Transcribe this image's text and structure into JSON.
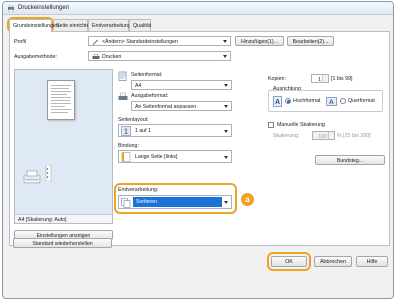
{
  "window": {
    "title": "Druckeinstellungen"
  },
  "tabs": [
    {
      "label": "Grundeinstellungen",
      "active": true
    },
    {
      "label": "Seite einrichten",
      "active": false
    },
    {
      "label": "Endverarbeitung",
      "active": false
    },
    {
      "label": "Qualität",
      "active": false
    }
  ],
  "profile": {
    "label": "Profil",
    "value": "<Ändern> Standardeinstellungen",
    "add_button": "Hinzufügen(1)...",
    "edit_button": "Bearbeiten(2)..."
  },
  "output_method": {
    "label": "Ausgabemethode:",
    "value": "Drucken"
  },
  "page_size": {
    "label": "Seitenformat:",
    "value": "A4"
  },
  "output_size": {
    "label": "Ausgabeformat:",
    "value": "An Seitenformat anpassen"
  },
  "copies": {
    "label": "Kopien:",
    "value": "1",
    "range": "[1 bis 99]"
  },
  "orientation": {
    "label": "Ausrichtung",
    "portrait": "Hochformat",
    "landscape": "Querformat",
    "selected": "portrait"
  },
  "page_layout": {
    "label": "Seitenlayout:",
    "value": "1 auf 1"
  },
  "manual_scaling": {
    "label": "Manuelle Skalierung",
    "scaling_label": "Skalierung:",
    "value": "100",
    "range": "% [25 bis 200]"
  },
  "binding": {
    "label": "Bindung:",
    "value": "Lange Seite [links]",
    "gutter_button": "Bundsteg..."
  },
  "finishing": {
    "label": "Endverarbeitung:",
    "value": "Sortieren",
    "callout": "a"
  },
  "preview": {
    "status": "A4 [Skalierung: Auto]"
  },
  "left_buttons": {
    "show_settings": "Einstellungen anzeigen",
    "restore_defaults": "Standard wiederherstellen"
  },
  "dialog_buttons": {
    "ok": "OK",
    "cancel": "Abbrechen",
    "help": "Hilfe"
  },
  "colors": {
    "accent_orange": "#f0a224",
    "selection_blue": "#1a73d9"
  }
}
